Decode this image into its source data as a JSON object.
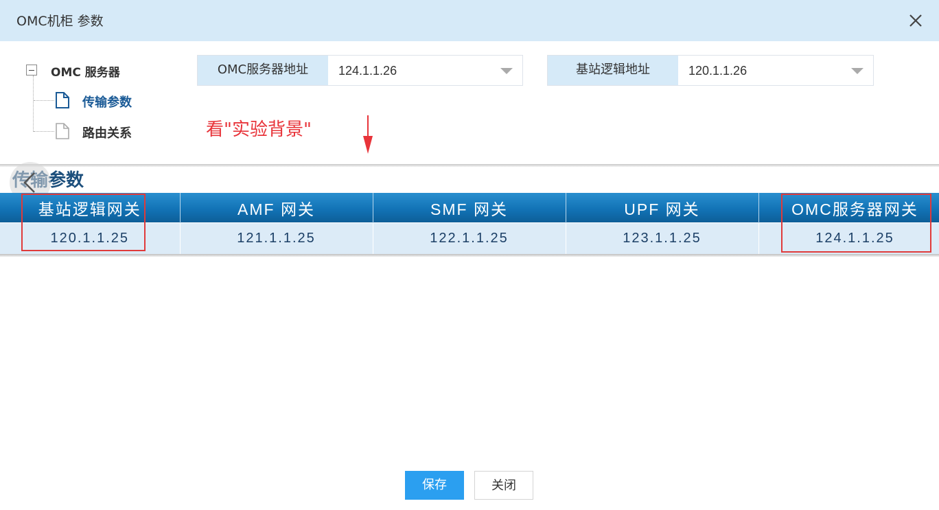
{
  "dialog": {
    "title": "OMC机柜 参数"
  },
  "tree": {
    "root_label": "OMC 服务器",
    "items": [
      {
        "label": "传输参数",
        "selected": true
      },
      {
        "label": "路由关系",
        "selected": false
      }
    ]
  },
  "fields": {
    "omc_address": {
      "label": "OMC服务器地址",
      "value": "124.1.1.26"
    },
    "bs_logical_address": {
      "label": "基站逻辑地址",
      "value": "120.1.1.26"
    }
  },
  "annotation": {
    "note": "看\"实验背景\""
  },
  "section": {
    "title": "传输参数"
  },
  "table": {
    "headers": [
      "基站逻辑网关",
      "AMF 网关",
      "SMF 网关",
      "UPF 网关",
      "OMC服务器网关"
    ],
    "row": [
      "120.1.1.25",
      "121.1.1.25",
      "122.1.1.25",
      "123.1.1.25",
      "124.1.1.25"
    ]
  },
  "buttons": {
    "save": "保存",
    "close": "关闭"
  },
  "colors": {
    "title_bar": "#d6eaf8",
    "selected_tree_item": "#1a5a96",
    "annotation": "#e8343a",
    "table_header": "#1273b6",
    "table_row": "#dcebf7",
    "primary_button": "#2b9ff0"
  }
}
